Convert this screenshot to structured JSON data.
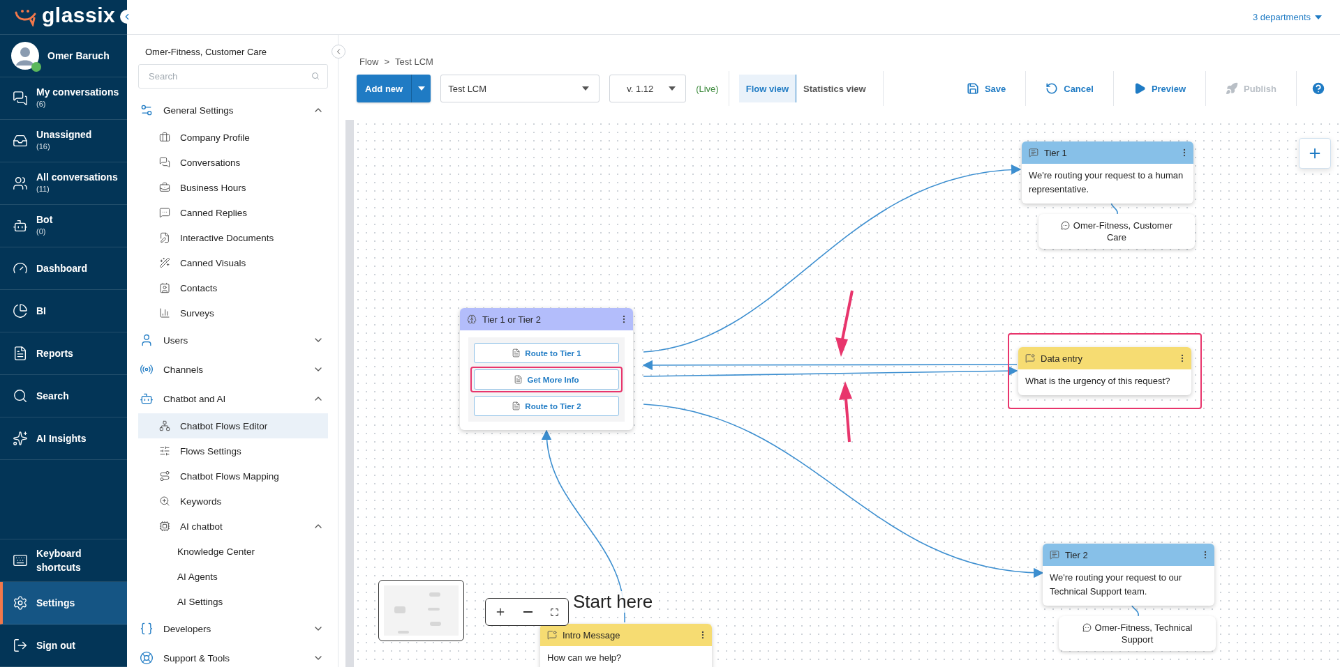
{
  "brand": {
    "name": "glassix"
  },
  "departments": "3 departments",
  "user": {
    "name": "Omer Baruch",
    "online": true
  },
  "nav": {
    "top": [
      {
        "label": "My conversations",
        "count": "(6)",
        "selected": false
      },
      {
        "label": "Unassigned",
        "count": "(16)",
        "selected": false
      },
      {
        "label": "All conversations",
        "count": "(11)",
        "selected": false
      },
      {
        "label": "Bot",
        "count": "(0)",
        "selected": false
      },
      {
        "label": "Dashboard",
        "selected": false
      },
      {
        "label": "BI",
        "selected": false
      },
      {
        "label": "Reports",
        "selected": false
      },
      {
        "label": "Search",
        "selected": false
      },
      {
        "label": "AI Insights",
        "selected": false
      }
    ],
    "bottom": [
      {
        "label": "Keyboard shortcuts",
        "selected": false
      },
      {
        "label": "Settings",
        "selected": true
      },
      {
        "label": "Sign out",
        "selected": false
      }
    ]
  },
  "settings_panel": {
    "title": "Omer-Fitness, Customer Care",
    "search": {
      "placeholder": "Search"
    },
    "sections": [
      {
        "label": "General Settings",
        "expanded": true,
        "children": [
          {
            "label": "Company Profile",
            "selected": false
          },
          {
            "label": "Conversations",
            "selected": false
          },
          {
            "label": "Business Hours",
            "selected": false
          },
          {
            "label": "Canned Replies",
            "selected": false
          },
          {
            "label": "Interactive Documents",
            "selected": false
          },
          {
            "label": "Canned Visuals",
            "selected": false
          },
          {
            "label": "Contacts",
            "selected": false
          },
          {
            "label": "Surveys",
            "selected": false
          }
        ]
      },
      {
        "label": "Users",
        "expanded": false
      },
      {
        "label": "Channels",
        "expanded": false
      },
      {
        "label": "Chatbot and AI",
        "expanded": true,
        "children": [
          {
            "label": "Chatbot Flows Editor",
            "selected": true
          },
          {
            "label": "Flows Settings",
            "selected": false
          },
          {
            "label": "Chatbot Flows Mapping",
            "selected": false
          },
          {
            "label": "Keywords",
            "selected": false
          },
          {
            "label": "AI chatbot",
            "selected": false,
            "expanded": true,
            "children": [
              {
                "label": "Knowledge Center",
                "selected": false
              },
              {
                "label": "AI Agents",
                "selected": false
              },
              {
                "label": "AI Settings",
                "selected": false
              }
            ]
          }
        ]
      },
      {
        "label": "Developers",
        "expanded": false
      },
      {
        "label": "Support & Tools",
        "expanded": false
      }
    ]
  },
  "breadcrumb": {
    "items": [
      "Flow",
      "Test LCM"
    ],
    "separator": ">"
  },
  "toolbar": {
    "add_new": "Add new",
    "flow": "Test LCM",
    "version": "v. 1.12",
    "status": "(Live)",
    "views": [
      {
        "label": "Flow view",
        "selected": true
      },
      {
        "label": "Statistics view",
        "selected": false
      }
    ],
    "actions": [
      {
        "kind": "save",
        "label": "Save",
        "disabled": false
      },
      {
        "kind": "cancel",
        "label": "Cancel",
        "disabled": false
      },
      {
        "kind": "preview",
        "label": "Preview",
        "disabled": false
      },
      {
        "kind": "publish",
        "label": "Publish",
        "disabled": true
      }
    ]
  },
  "canvas": {
    "start_label": "Start here",
    "nodes": [
      {
        "kind": "message",
        "title": "Tier 1",
        "text": "We're routing your request to a human representative.",
        "highlighted": false,
        "assignee": "Omer-Fitness, Customer Care"
      },
      {
        "kind": "condition",
        "title": "Tier 1 or Tier 2",
        "highlighted": false,
        "options": [
          {
            "label": "Route to Tier 1",
            "highlighted": false
          },
          {
            "label": "Get More Info",
            "highlighted": true
          },
          {
            "label": "Route to Tier 2",
            "highlighted": false
          }
        ]
      },
      {
        "kind": "question",
        "title": "Data entry",
        "text": "What is the urgency of this request?",
        "highlighted": true
      },
      {
        "kind": "message",
        "title": "Tier 2",
        "text": "We're routing your request to our Technical Support team.",
        "highlighted": false,
        "assignee": "Omer-Fitness, Technical Support"
      },
      {
        "kind": "question",
        "title": "Intro Message",
        "text": "How can we help?",
        "highlighted": false
      }
    ]
  }
}
